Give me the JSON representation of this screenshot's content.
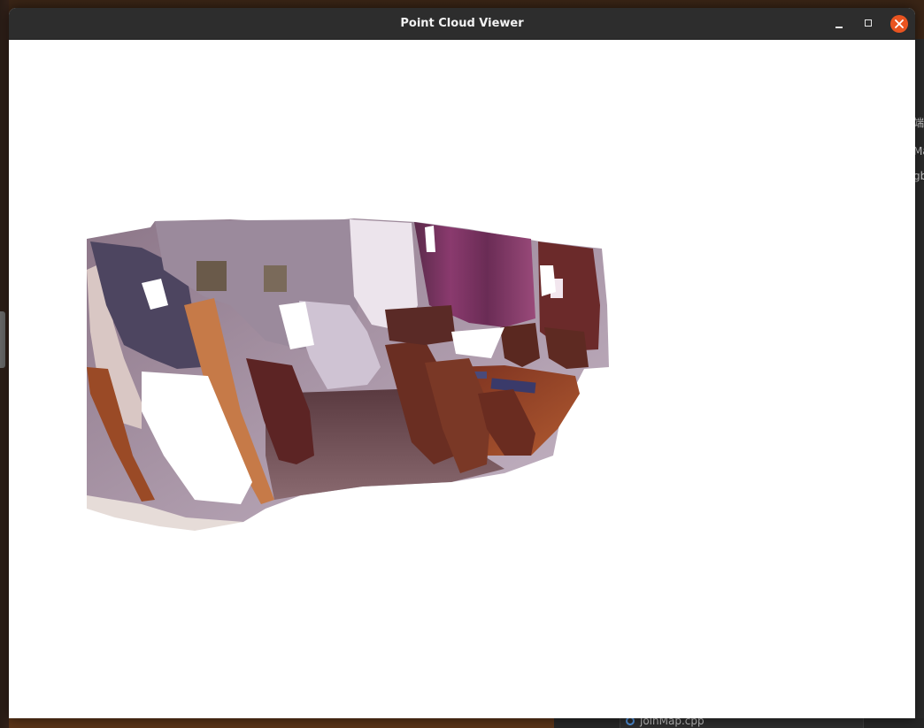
{
  "window": {
    "title": "Point Cloud Viewer",
    "controls": {
      "minimize": "minimize",
      "maximize": "maximize",
      "close": "close"
    },
    "accent_close": "#e95420",
    "titlebar_color": "#2d2d2d"
  },
  "viewport": {
    "background": "#ffffff",
    "content": "point-cloud-render"
  },
  "background_window": {
    "snippets": [
      "端",
      "Ma",
      "gb"
    ],
    "open_file": "joinMap.cpp"
  }
}
